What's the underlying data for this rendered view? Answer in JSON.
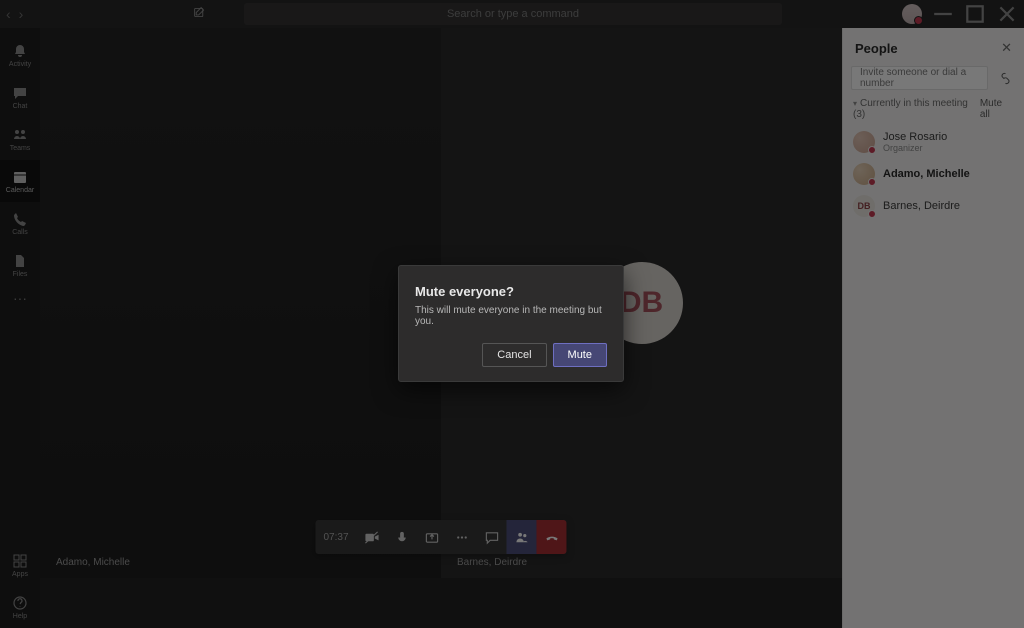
{
  "titlebar": {
    "search_placeholder": "Search or type a command"
  },
  "rail": {
    "items": [
      {
        "label": "Activity"
      },
      {
        "label": "Chat"
      },
      {
        "label": "Teams"
      },
      {
        "label": "Calendar"
      },
      {
        "label": "Calls"
      },
      {
        "label": "Files"
      }
    ],
    "bottom": [
      {
        "label": "Apps"
      },
      {
        "label": "Help"
      }
    ],
    "active_index": 3
  },
  "meeting": {
    "timer": "07:37",
    "tiles": [
      {
        "name": "Adamo, Michelle"
      },
      {
        "name": "Barnes, Deirdre",
        "initials": "DB"
      }
    ]
  },
  "people_panel": {
    "title": "People",
    "invite_placeholder": "Invite someone or dial a number",
    "section_label": "Currently in this meeting",
    "section_count": "(3)",
    "mute_all_label": "Mute all",
    "participants": [
      {
        "name": "Jose Rosario",
        "sub": "Organizer",
        "avatar": "jr",
        "bold": false
      },
      {
        "name": "Adamo, Michelle",
        "sub": "",
        "avatar": "am",
        "bold": true
      },
      {
        "name": "Barnes, Deirdre",
        "sub": "",
        "avatar": "db",
        "initials": "DB",
        "bold": false
      }
    ]
  },
  "dialog": {
    "title": "Mute everyone?",
    "body": "This will mute everyone in the meeting but you.",
    "cancel": "Cancel",
    "confirm": "Mute"
  }
}
